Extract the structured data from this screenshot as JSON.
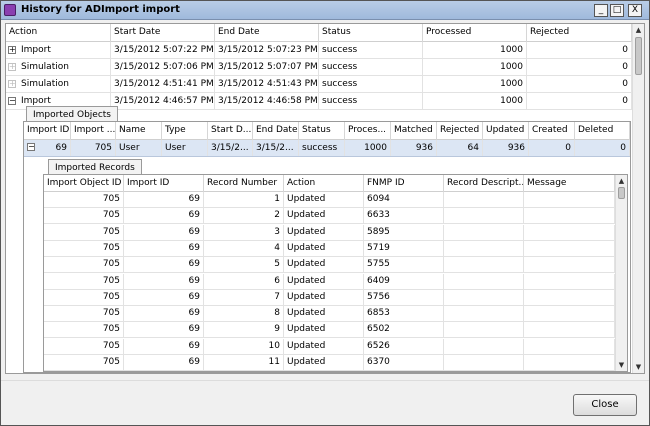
{
  "window": {
    "title": "History for ADImport import",
    "minimize": "_",
    "maximize": "□",
    "close": "X"
  },
  "history": {
    "headers": [
      "Action",
      "Start Date",
      "End Date",
      "Status",
      "Processed",
      "Rejected"
    ],
    "rows": [
      {
        "expander": "+",
        "action": "Import",
        "start": "3/15/2012 5:07:22 PM",
        "end": "3/15/2012 5:07:23 PM",
        "status": "success",
        "processed": "1000",
        "rejected": "0"
      },
      {
        "expander": "+",
        "action": "Simulation",
        "start": "3/15/2012 5:07:06 PM",
        "end": "3/15/2012 5:07:07 PM",
        "status": "success",
        "processed": "1000",
        "rejected": "0"
      },
      {
        "expander": "+",
        "action": "Simulation",
        "start": "3/15/2012 4:51:41 PM",
        "end": "3/15/2012 4:51:43 PM",
        "status": "success",
        "processed": "1000",
        "rejected": "0"
      },
      {
        "expander": "−",
        "action": "Import",
        "start": "3/15/2012 4:46:57 PM",
        "end": "3/15/2012 4:46:58 PM",
        "status": "success",
        "processed": "1000",
        "rejected": "0"
      }
    ]
  },
  "imported_objects": {
    "tab_label": "Imported Objects",
    "headers": [
      "Import ID",
      "Import ...",
      "Name",
      "Type",
      "Start D...",
      "End Date",
      "Status",
      "Proces...",
      "Matched",
      "Rejected",
      "Updated",
      "Created",
      "Deleted"
    ],
    "row": {
      "expander": "−",
      "cells": [
        "69",
        "705",
        "User",
        "User",
        "3/15/2...",
        "3/15/2...",
        "success",
        "1000",
        "936",
        "64",
        "936",
        "0",
        "0"
      ]
    }
  },
  "imported_records": {
    "tab_label": "Imported Records",
    "headers": [
      "Import Object ID",
      "Import ID",
      "Record Number",
      "Action",
      "FNMP ID",
      "Record Descript...",
      "Message"
    ],
    "rows": [
      [
        "705",
        "69",
        "1",
        "Updated",
        "6094",
        "",
        ""
      ],
      [
        "705",
        "69",
        "2",
        "Updated",
        "6633",
        "",
        ""
      ],
      [
        "705",
        "69",
        "3",
        "Updated",
        "5895",
        "",
        ""
      ],
      [
        "705",
        "69",
        "4",
        "Updated",
        "5719",
        "",
        ""
      ],
      [
        "705",
        "69",
        "5",
        "Updated",
        "5755",
        "",
        ""
      ],
      [
        "705",
        "69",
        "6",
        "Updated",
        "6409",
        "",
        ""
      ],
      [
        "705",
        "69",
        "7",
        "Updated",
        "5756",
        "",
        ""
      ],
      [
        "705",
        "69",
        "8",
        "Updated",
        "6853",
        "",
        ""
      ],
      [
        "705",
        "69",
        "9",
        "Updated",
        "6502",
        "",
        ""
      ],
      [
        "705",
        "69",
        "10",
        "Updated",
        "6526",
        "",
        ""
      ],
      [
        "705",
        "69",
        "11",
        "Updated",
        "6370",
        "",
        ""
      ]
    ]
  },
  "footer": {
    "close_label": "Close"
  }
}
